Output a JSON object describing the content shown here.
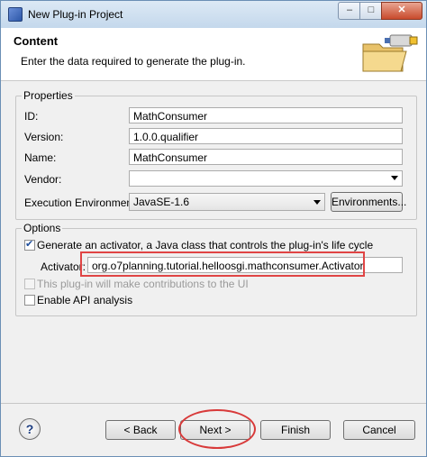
{
  "window": {
    "title": "New Plug-in Project",
    "controls": {
      "minimize": "–",
      "maximize": "□",
      "close": "✕"
    }
  },
  "header": {
    "title": "Content",
    "description": "Enter the data required to generate the plug-in.",
    "icon": "folder-wizard-icon"
  },
  "properties": {
    "group_label": "Properties",
    "id": {
      "label": "ID:",
      "value": "MathConsumer"
    },
    "version": {
      "label": "Version:",
      "value": "1.0.0.qualifier"
    },
    "name": {
      "label": "Name:",
      "value": "MathConsumer"
    },
    "vendor": {
      "label": "Vendor:",
      "value": ""
    },
    "execution_environment": {
      "label": "Execution Environment:",
      "value": "JavaSE-1.6"
    },
    "environments_button": "Environments..."
  },
  "options": {
    "group_label": "Options",
    "generate_activator": {
      "label": "Generate an activator, a Java class that controls the plug-in's life cycle",
      "checked": true
    },
    "activator": {
      "label": "Activator:",
      "value": "org.o7planning.tutorial.helloosgi.mathconsumer.Activator"
    },
    "ui_contributions": {
      "label": "This plug-in will make contributions to the UI",
      "checked": false,
      "enabled": false
    },
    "api_analysis": {
      "label": "Enable API analysis",
      "checked": false
    }
  },
  "buttons": {
    "help": "?",
    "back": "< Back",
    "next": "Next >",
    "finish": "Finish",
    "cancel": "Cancel"
  },
  "colors": {
    "annotation": "#e04545",
    "checkmark": "#1f4f9c"
  }
}
